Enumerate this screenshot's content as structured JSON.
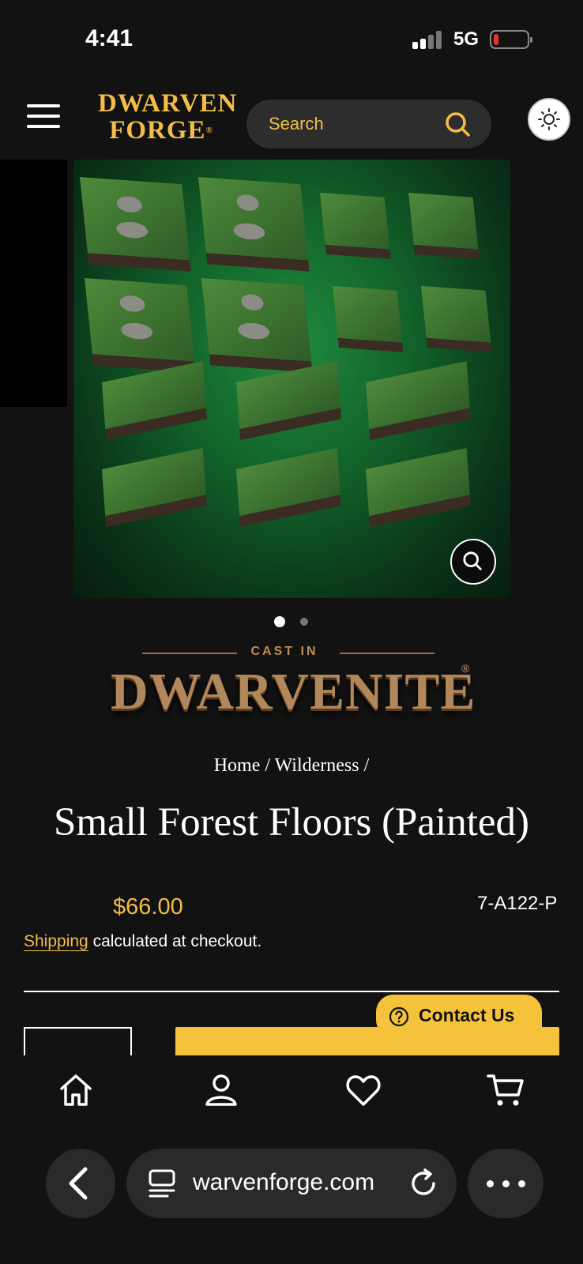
{
  "status_bar": {
    "time": "4:41",
    "network": "5G"
  },
  "header": {
    "logo_line1": "DWARVEN",
    "logo_line2": "FORGE",
    "logo_reg": "®",
    "search_placeholder": "Search"
  },
  "gallery": {
    "slide_count": 2,
    "active_slide": 1
  },
  "badge": {
    "cast_in": "CAST IN",
    "word": "DWARVENITE",
    "reg": "®"
  },
  "breadcrumb": "Home / Wilderness /",
  "product": {
    "title": "Small Forest Floors (Painted)",
    "price": "$66.00",
    "sku": "7-A122-P",
    "shipping_link": "Shipping",
    "shipping_text": " calculated at checkout."
  },
  "contact": {
    "label": "Contact Us"
  },
  "bottom_nav": [
    "home-icon",
    "account-icon",
    "wishlist-icon",
    "cart-icon"
  ],
  "browser": {
    "url": "warvenforge.com"
  },
  "colors": {
    "accent": "#f3bd47",
    "background": "#121212",
    "button": "#f5c33b"
  }
}
